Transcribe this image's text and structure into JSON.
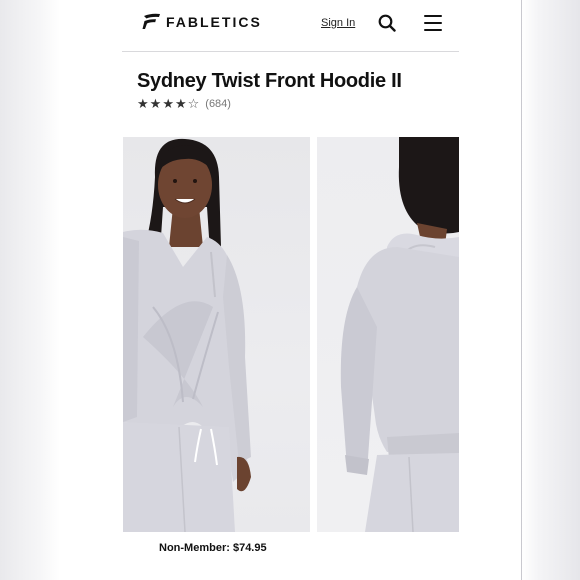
{
  "header": {
    "brand": "FABLETICS",
    "sign_in": "Sign In",
    "icons": {
      "logo": "fabletics-logo-icon",
      "search": "search-icon",
      "menu": "hamburger-menu-icon"
    }
  },
  "product": {
    "title": "Sydney Twist Front Hoodie II",
    "rating": 4,
    "rating_max": 5,
    "review_count": "(684)",
    "price_label": "Non-Member:",
    "price_value": "$74.95"
  },
  "images": [
    {
      "name": "product-photo-front"
    },
    {
      "name": "product-photo-back"
    }
  ],
  "colors": {
    "hoodie": "#d4d4dc",
    "skin": "#6b4330",
    "hair": "#1c1717",
    "background": "#ebebee"
  }
}
